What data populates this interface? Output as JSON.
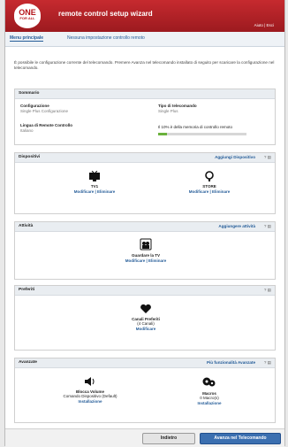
{
  "header": {
    "logo_line1": "ONE",
    "logo_line2": "FOR ALL",
    "title": "remote control setup wizard",
    "link": "Aiuto | Esci"
  },
  "tabs": [
    {
      "label": "Menu principale"
    },
    {
      "label": "Nessuna impostazione controllo remoto"
    }
  ],
  "intro": "È possibile le configurazione corrente del telecomando. Premere Avanza nel telecomando installato di seguito per scaricare la configurazione nel telecomando.",
  "summary": {
    "title": "Sommario",
    "config_label": "Configurazione",
    "config_value": "Single Plus Configurazione",
    "type_label": "Tipo di telecomando",
    "type_value": "Single Plus",
    "lang_label": "Lingua di Remote Controllo",
    "lang_value": "Italiano",
    "memory_label": "Il 10% è della memoria di controllo remoto",
    "memory_percent": 10
  },
  "devices": {
    "title": "Dispositivi",
    "link": "Aggiungi Dispositivo",
    "ctrl": "? ▤",
    "items": [
      {
        "name": "TV1",
        "links": "Modificare | Eliminare",
        "icon": "tv-icon"
      },
      {
        "name": "STORE",
        "links": "Modificare | Eliminare",
        "icon": "audio-icon"
      }
    ]
  },
  "activities": {
    "title": "Attività",
    "link": "Aggiungere attività",
    "ctrl": "? ▤",
    "item": {
      "name": "Guardare la TV",
      "links": "Modificare | Eliminare",
      "icon": "watch-tv-icon"
    }
  },
  "favorites": {
    "title": "Preferiti",
    "ctrl": "? ▤",
    "item": {
      "name": "Canali Preferiti",
      "count": "(4 Canali)",
      "links": "Modificare",
      "icon": "heart-icon"
    }
  },
  "advanced": {
    "title": "Avanzate",
    "link": "Più funzionalità Avanzate",
    "ctrl": "? ▤",
    "items": [
      {
        "name": "Blocca Volume",
        "sub": "Comando Dispositivo (Default)",
        "links": "Installazione",
        "icon": "volume-icon"
      },
      {
        "name": "Macros",
        "sub": "0 Macro(s)",
        "links": "Installazione",
        "icon": "macro-icon"
      }
    ]
  },
  "footer": {
    "back": "Indietro",
    "download": "Avanza nel Telecomando"
  },
  "colors": {
    "brand_red": "#b5151b",
    "link_blue": "#245c98",
    "progress_green": "#6ab13c"
  }
}
